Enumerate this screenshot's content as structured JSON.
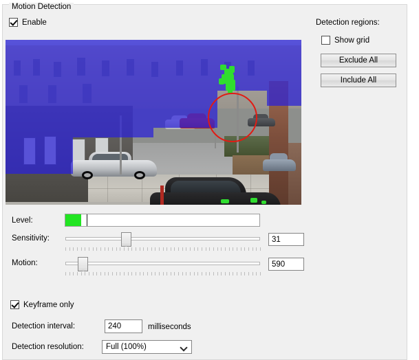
{
  "window": {
    "group_title": "Motion Detection"
  },
  "enable": {
    "label": "Enable",
    "checked": true
  },
  "detection_regions": {
    "title": "Detection regions:",
    "show_grid": {
      "label": "Show grid",
      "checked": false
    },
    "exclude_all_label": "Exclude All",
    "include_all_label": "Include All"
  },
  "preview": {
    "mask_color": "#2a20d8",
    "motion_pixel_color": "#30dd30",
    "detection_circle_color": "#e11b14"
  },
  "level": {
    "label": "Level:",
    "fill_percent": 8,
    "threshold_percent": 11,
    "fill_color": "#22e522"
  },
  "sensitivity": {
    "label": "Sensitivity:",
    "value": "31",
    "percent": 31
  },
  "motion": {
    "label": "Motion:",
    "value": "590",
    "percent": 9
  },
  "keyframe_only": {
    "label": "Keyframe only",
    "checked": true
  },
  "detection_interval": {
    "label": "Detection interval:",
    "value": "240",
    "units": "milliseconds"
  },
  "detection_resolution": {
    "label": "Detection resolution:",
    "value": "Full (100%)",
    "options": [
      "Full (100%)"
    ]
  }
}
